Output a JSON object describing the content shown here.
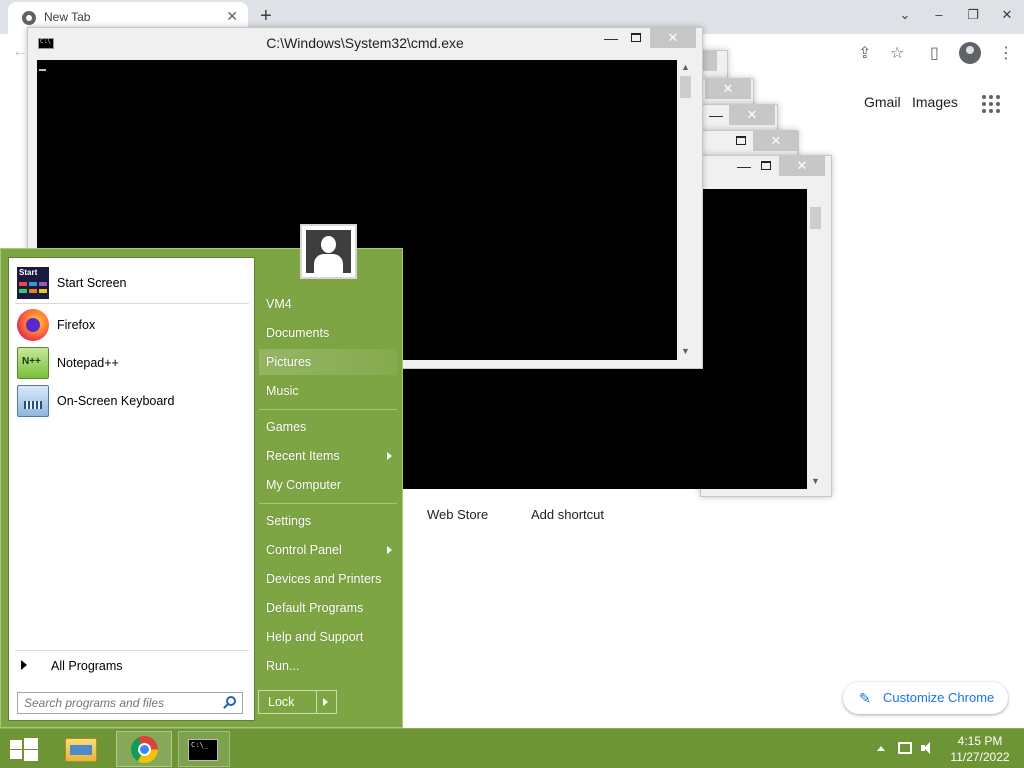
{
  "chrome": {
    "tab_title": "New Tab",
    "tab_close": "✕",
    "new_tab": "+",
    "win_minimize": "⌄",
    "win_min": "–",
    "win_restore": "❐",
    "win_close": "✕",
    "toolbar": {
      "back": "←",
      "share": "⇪",
      "star": "☆",
      "sidepanel": "▯",
      "menu": "⋮"
    },
    "gmail": "Gmail",
    "images": "Images",
    "web_store": "Web Store",
    "add_shortcut": "Add shortcut",
    "customize": "Customize Chrome",
    "pen": "✎"
  },
  "cmd": {
    "title": "C:\\Windows\\System32\\cmd.exe",
    "minimize": "—",
    "close": "✕"
  },
  "start_menu": {
    "pinned": [
      {
        "label": "Start Screen",
        "icon": "start-screen-icon"
      },
      {
        "label": "Firefox",
        "icon": "firefox-icon"
      },
      {
        "label": "Notepad++",
        "icon": "notepad-plus-plus-icon"
      },
      {
        "label": "On-Screen Keyboard",
        "icon": "keyboard-icon"
      }
    ],
    "all_programs": "All Programs",
    "search_placeholder": "Search programs and files",
    "right": {
      "user": "VM4",
      "documents": "Documents",
      "pictures": "Pictures",
      "music": "Music",
      "games": "Games",
      "recent_items": "Recent Items",
      "my_computer": "My Computer",
      "settings": "Settings",
      "control_panel": "Control Panel",
      "devices_printers": "Devices and Printers",
      "default_programs": "Default Programs",
      "help_support": "Help and Support",
      "run": "Run..."
    },
    "lock": "Lock"
  },
  "taskbar": {
    "time": "4:15 PM",
    "date": "11/27/2022"
  },
  "colors": {
    "start_menu_bg": "#7ea543",
    "taskbar_bg": "#6d9535",
    "chrome_tabstrip": "#dee1e6",
    "accent_blue": "#1a73e8"
  }
}
